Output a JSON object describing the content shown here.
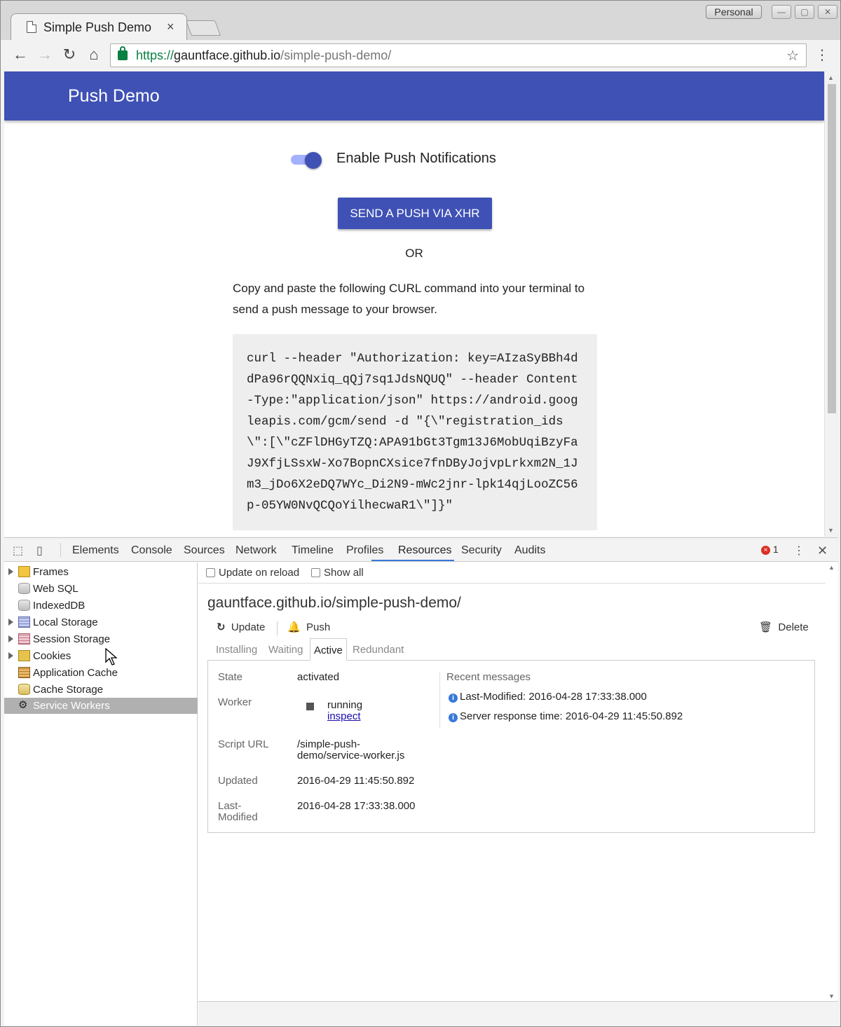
{
  "window": {
    "tab_title": "Simple Push Demo",
    "tab_close": "×",
    "profile": "Personal",
    "min_btn": "—",
    "max_btn": "▢",
    "close_btn": "✕"
  },
  "toolbar": {
    "url_scheme": "https://",
    "url_host": "gauntface.github.io",
    "url_path": "/simple-push-demo/"
  },
  "page": {
    "appbar_title": "Push Demo",
    "switch_label": "Enable Push Notifications",
    "switch_on": true,
    "push_button": "SEND A PUSH VIA XHR",
    "or_text": "OR",
    "instructions": "Copy and paste the following CURL command into your terminal to send a push message to your browser.",
    "curl": "curl --header \"Authorization: key=AIzaSyBBh4ddPa96rQQNxiq_qQj7sq1JdsNQUQ\" --header Content-Type:\"application/json\" https://android.googleapis.com/gcm/send -d \"{\\\"registration_ids\\\":[\\\"cZFlDHGyTZQ:APA91bGt3Tgm13J6MobUqiBzyFaJ9XfjLSsxW-Xo7BopnCXsice7fnDByJojvpLrkxm2N_1Jm3_jDo6X2eDQ7WYc_Di2N9-mWc2jnr-lpk14qjLooZC56p-05YW0NvQCQoYilhecwaR1\\\"]}\""
  },
  "devtools": {
    "tabs": [
      "Elements",
      "Console",
      "Sources",
      "Network",
      "Timeline",
      "Profiles",
      "Resources",
      "Security",
      "Audits"
    ],
    "active_tab": "Resources",
    "error_count": "1",
    "error_icon": "×",
    "sidebar": [
      {
        "label": "Frames",
        "icon": "folder-icon",
        "expandable": true
      },
      {
        "label": "Web SQL",
        "icon": "database-icon",
        "expandable": false
      },
      {
        "label": "IndexedDB",
        "icon": "database-icon",
        "expandable": false
      },
      {
        "label": "Local Storage",
        "icon": "grid-icon",
        "expandable": true
      },
      {
        "label": "Session Storage",
        "icon": "grid-icon",
        "expandable": true
      },
      {
        "label": "Cookies",
        "icon": "cookie-icon",
        "expandable": true
      },
      {
        "label": "Application Cache",
        "icon": "appcache-icon",
        "expandable": false
      },
      {
        "label": "Cache Storage",
        "icon": "cache-icon",
        "expandable": false
      },
      {
        "label": "Service Workers",
        "icon": "gear-icon",
        "expandable": false,
        "selected": true
      }
    ],
    "options": {
      "update_on_reload": "Update on reload",
      "show_all": "Show all"
    },
    "origin": "gauntface.github.io/simple-push-demo/",
    "actions": {
      "update": "Update",
      "push": "Push",
      "delete": "Delete"
    },
    "subtabs": [
      "Installing",
      "Waiting",
      "Active",
      "Redundant"
    ],
    "active_subtab": "Active",
    "worker": {
      "state_label": "State",
      "state_value": "activated",
      "worker_label": "Worker",
      "worker_status": "running",
      "worker_inspect": "inspect",
      "script_label": "Script URL",
      "script_value": "/simple-push-demo/service-worker.js",
      "updated_label": "Updated",
      "updated_value": "2016-04-29 11:45:50.892",
      "lastmod_label": "Last-Modified",
      "lastmod_value": "2016-04-28 17:33:38.000"
    },
    "messages": {
      "header": "Recent messages",
      "items": [
        "Last-Modified: 2016-04-28 17:33:38.000",
        "Server response time: 2016-04-29 11:45:50.892"
      ]
    }
  },
  "colors": {
    "appbar": "#3f51b5",
    "accent": "#3879d9",
    "secure": "#0b8043"
  }
}
